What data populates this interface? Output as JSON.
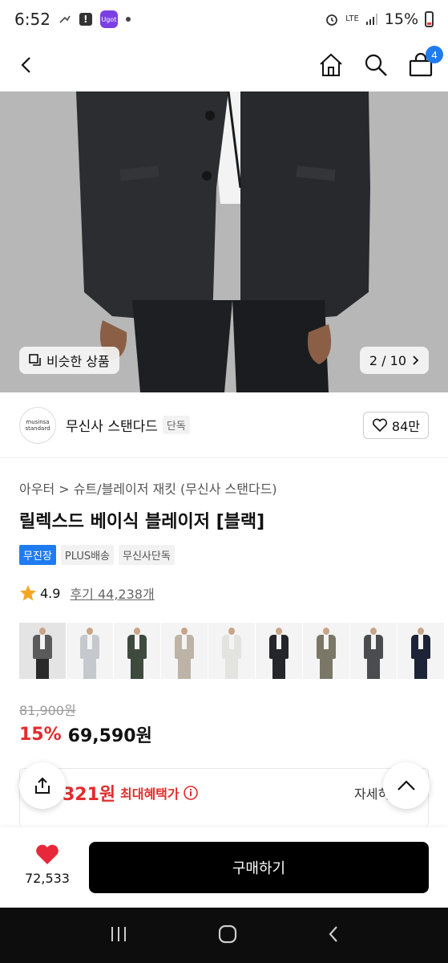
{
  "status_bar": {
    "time": "6:52",
    "app_icon_label": "Ugot",
    "network": "LTE",
    "battery": "15%"
  },
  "header": {
    "cart_count": "4"
  },
  "hero": {
    "similar_label": "비슷한 상품",
    "pager": "2 / 10"
  },
  "brand": {
    "logo_line1": "musinsa",
    "logo_line2": "standard",
    "name": "무신사 스탠다드",
    "tag": "단독",
    "likes": "84만"
  },
  "product": {
    "breadcrumb": "아우터 > 슈트/블레이저 재킷 (무신사 스탠다드)",
    "title": "릴렉스드 베이식 블레이저 [블랙]",
    "badges": [
      "무진장",
      "PLUS배송",
      "무신사단독"
    ],
    "rating": "4.9",
    "reviews": "후기 44,238개",
    "original_price": "81,900원",
    "discount": "15%",
    "price": "69,590원",
    "benefit_price": "321원",
    "benefit_label": "최대혜택가",
    "benefit_detail": "자세히"
  },
  "swatches": [
    {
      "jacket": "#5b5b5b",
      "pants": "#2a2a2a",
      "selected": true
    },
    {
      "jacket": "#c5c8cc",
      "pants": "#c5c8cc",
      "selected": false
    },
    {
      "jacket": "#3e4a3d",
      "pants": "#3e4a3d",
      "selected": false
    },
    {
      "jacket": "#bdb3a6",
      "pants": "#bdb3a6",
      "selected": false
    },
    {
      "jacket": "#e3e3e0",
      "pants": "#e3e3e0",
      "selected": false
    },
    {
      "jacket": "#24262b",
      "pants": "#24262b",
      "selected": false
    },
    {
      "jacket": "#7a7766",
      "pants": "#7a7766",
      "selected": false
    },
    {
      "jacket": "#4a4c50",
      "pants": "#4a4c50",
      "selected": false
    },
    {
      "jacket": "#1d2438",
      "pants": "#1d2438",
      "selected": false
    }
  ],
  "buy_bar": {
    "wish_count": "72,533",
    "buy_label": "구매하기"
  },
  "colors": {
    "accent_blue": "#1f7bf0",
    "sale_red": "#e22c2c",
    "heart_red": "#e8283a"
  }
}
